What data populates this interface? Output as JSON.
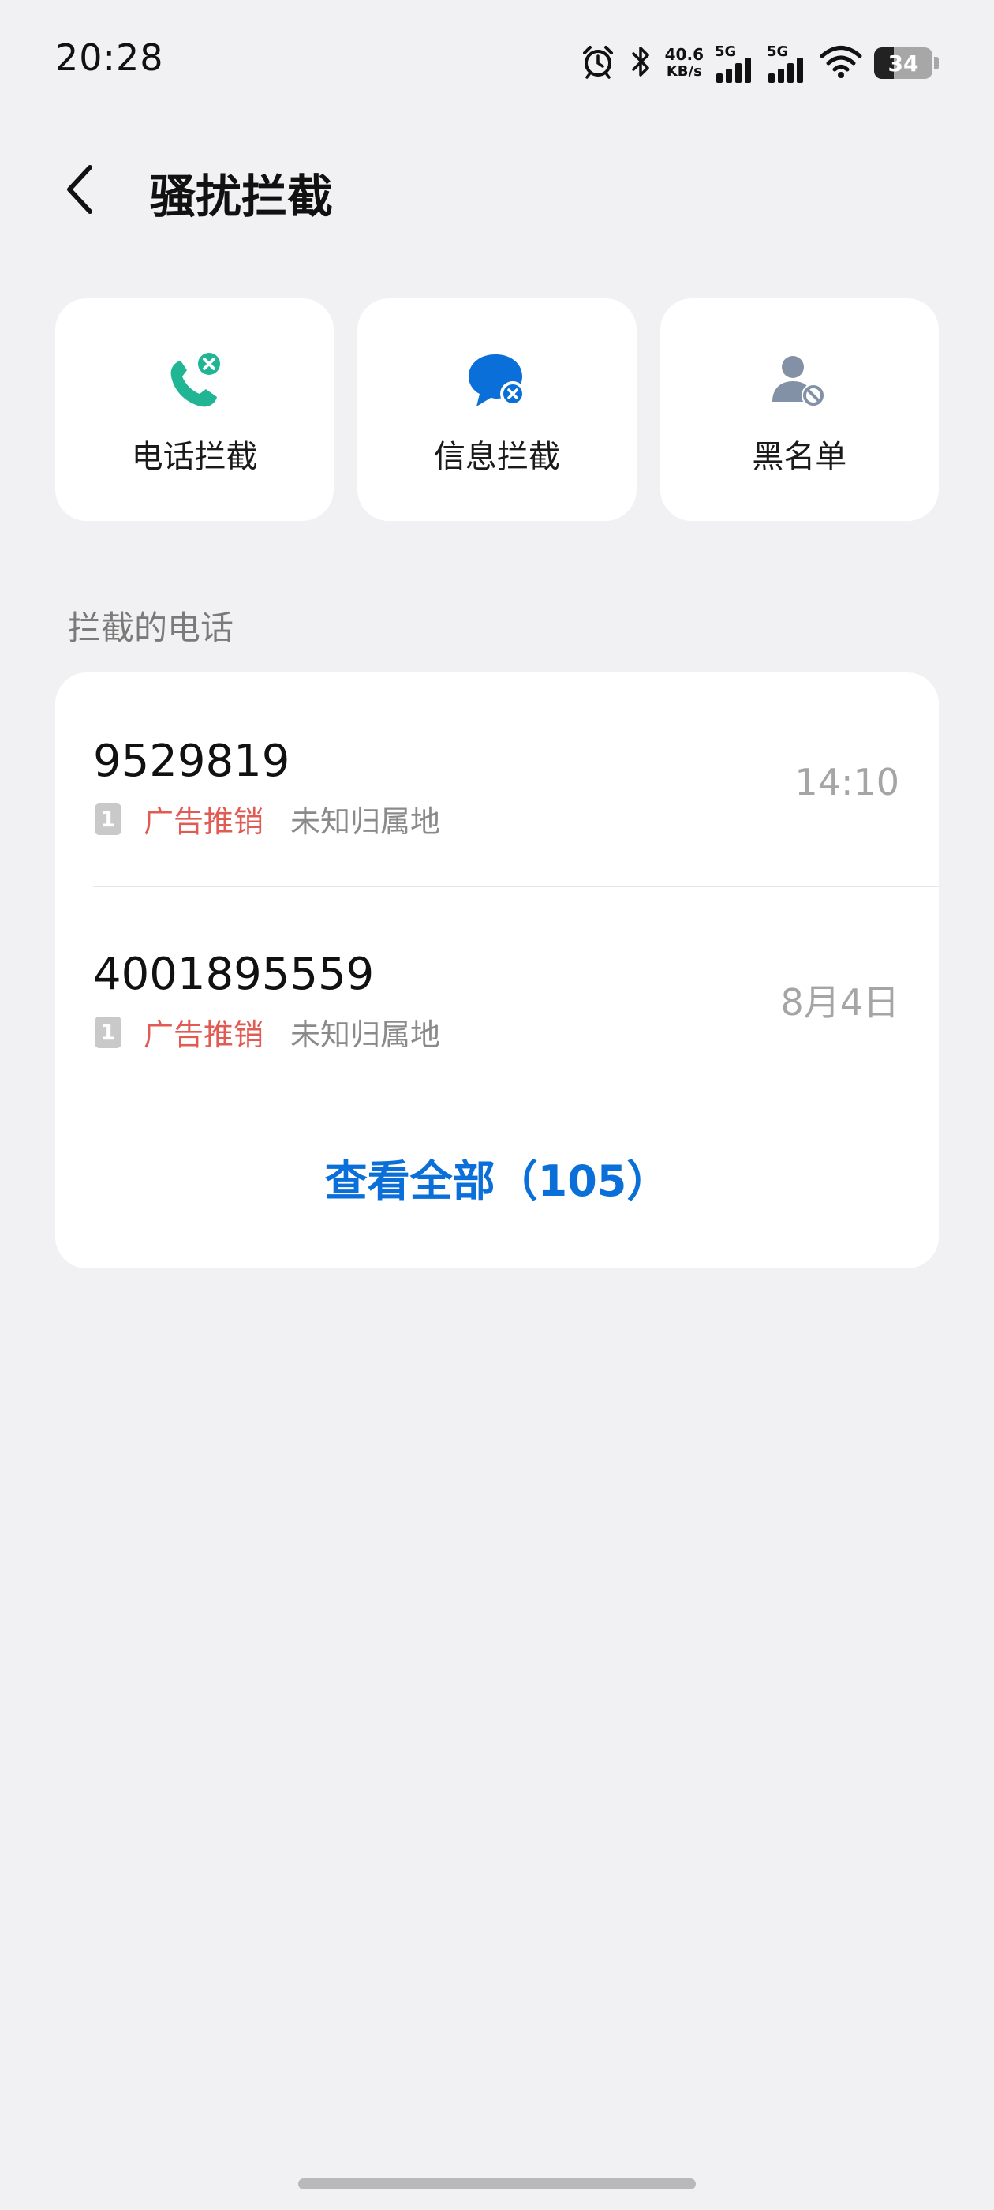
{
  "status_bar": {
    "time": "20:28",
    "net_speed_value": "40.6",
    "net_speed_unit": "KB/s",
    "sim1_gen": "5G",
    "sim2_gen": "5G",
    "battery": "34",
    "battery_level": 0.34,
    "icons": [
      "alarm-icon",
      "bluetooth-icon",
      "signal-icon",
      "signal-icon",
      "wifi-icon",
      "battery-icon"
    ]
  },
  "header": {
    "title": "骚扰拦截",
    "back_icon": "chevron-left-icon"
  },
  "quick_actions": [
    {
      "label": "电话拦截",
      "icon": "phone-block-icon",
      "color": "#1fb595"
    },
    {
      "label": "信息拦截",
      "icon": "message-block-icon",
      "color": "#0a6fd8"
    },
    {
      "label": "黑名单",
      "icon": "blacklist-user-icon",
      "color": "#8391a6"
    }
  ],
  "calls_section": {
    "title": "拦截的电话",
    "items": [
      {
        "number": "9529819",
        "sim": "1",
        "tag": "广告推销",
        "location": "未知归属地",
        "time": "14:10"
      },
      {
        "number": "4001895559",
        "sim": "1",
        "tag": "广告推销",
        "location": "未知归属地",
        "time": "8月4日"
      }
    ],
    "view_all": "查看全部（105）"
  },
  "colors": {
    "background": "#f1f1f3",
    "accent": "#0a6fd8",
    "tag_red": "#e05b54",
    "phone_green": "#1fb595"
  }
}
